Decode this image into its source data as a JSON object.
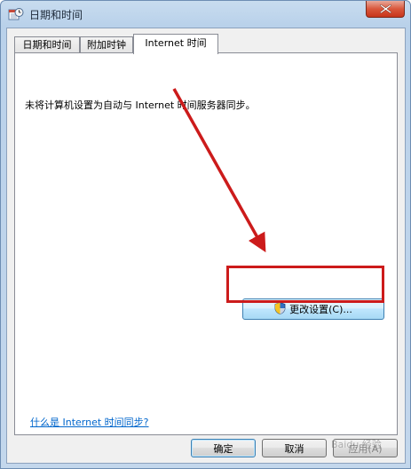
{
  "window": {
    "title": "日期和时间",
    "icon": "clock-calendar-icon"
  },
  "tabs": [
    {
      "label": "日期和时间",
      "active": false
    },
    {
      "label": "附加时钟",
      "active": false
    },
    {
      "label": "Internet 时间",
      "active": true
    }
  ],
  "panel": {
    "status_text": "未将计算机设置为自动与 Internet 时间服务器同步。",
    "change_button_label": "更改设置(C)...",
    "change_button_icon": "uac-shield-icon",
    "help_link": "什么是 Internet 时间同步?"
  },
  "buttons": {
    "ok": "确定",
    "cancel": "取消",
    "apply": "应用(A)"
  },
  "annotation": {
    "color": "#cc1b1b"
  },
  "watermark": "Baidu 经验"
}
